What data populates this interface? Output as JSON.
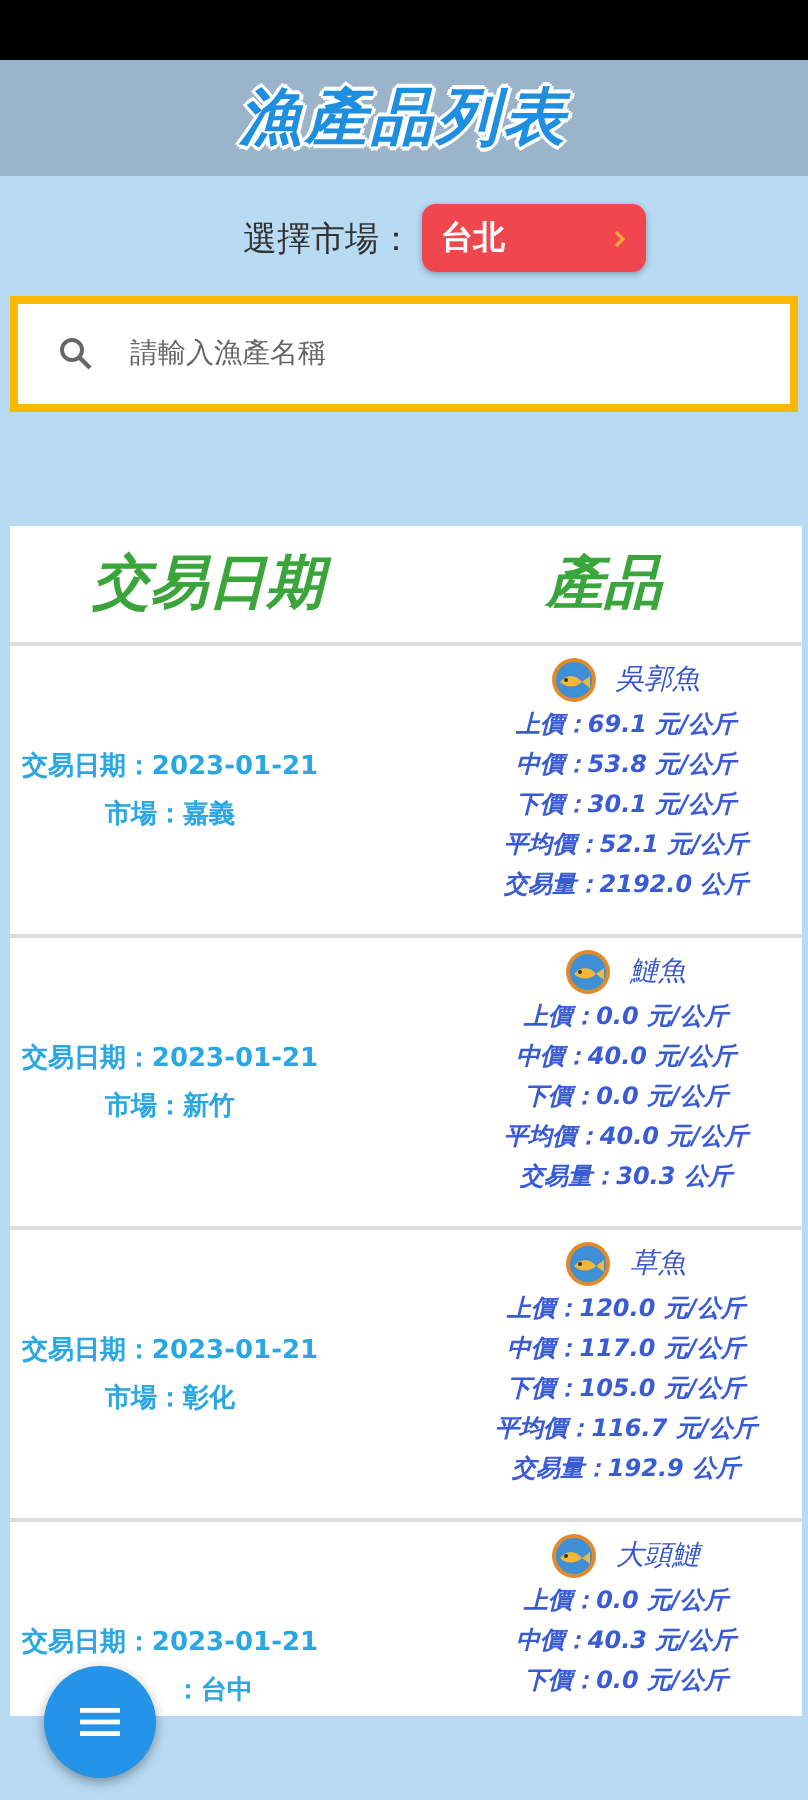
{
  "title": "漁產品列表",
  "market_picker": {
    "label": "選擇市場：",
    "value": "台北"
  },
  "search": {
    "placeholder": "請輸入漁產名稱"
  },
  "table": {
    "columns": [
      "交易日期",
      "產品"
    ],
    "rows": [
      {
        "date": "交易日期：2023-01-21",
        "market": "市場：嘉義",
        "product": "吳郭魚",
        "details": [
          "上價：69.1 元/公斤",
          "中價：53.8 元/公斤",
          "下價：30.1 元/公斤",
          "平均價：52.1 元/公斤",
          "交易量：2192.0 公斤"
        ]
      },
      {
        "date": "交易日期：2023-01-21",
        "market": "市場：新竹",
        "product": "鰱魚",
        "details": [
          "上價：0.0 元/公斤",
          "中價：40.0 元/公斤",
          "下價：0.0 元/公斤",
          "平均價：40.0 元/公斤",
          "交易量：30.3 公斤"
        ]
      },
      {
        "date": "交易日期：2023-01-21",
        "market": "市場：彰化",
        "product": "草魚",
        "details": [
          "上價：120.0 元/公斤",
          "中價：117.0 元/公斤",
          "下價：105.0 元/公斤",
          "平均價：116.7 元/公斤",
          "交易量：192.9 公斤"
        ]
      },
      {
        "date": "交易日期：2023-01-21",
        "market": "：台中",
        "product": "大頭鰱",
        "details": [
          "上價：0.0 元/公斤",
          "中價：40.3 元/公斤",
          "下價：0.0 元/公斤"
        ]
      }
    ]
  }
}
